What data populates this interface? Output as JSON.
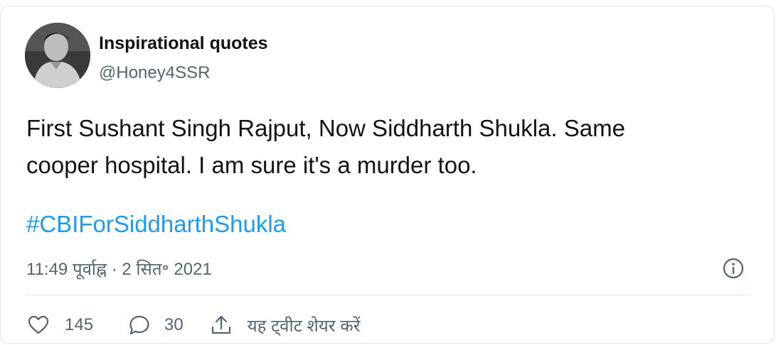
{
  "author": {
    "display_name": "Inspirational quotes",
    "handle": "@Honey4SSR"
  },
  "tweet": {
    "text_line1": "First Sushant Singh Rajput, Now Siddharth Shukla. Same",
    "text_line2": "cooper hospital. I am sure it's a murder too.",
    "hashtag": "#CBIForSiddharthShukla",
    "timestamp": "11:49 पूर्वाह्न · 2 सित॰ 2021"
  },
  "actions": {
    "like_count": "145",
    "reply_count": "30",
    "share_label": "यह ट्वीट शेयर करें"
  },
  "icons": [
    "avatar-photo",
    "info-icon",
    "heart-icon",
    "reply-icon",
    "share-icon"
  ],
  "colors": {
    "text": "#0f1419",
    "secondary": "#536471",
    "link": "#1d9bf0",
    "border": "#dfe3e6"
  }
}
